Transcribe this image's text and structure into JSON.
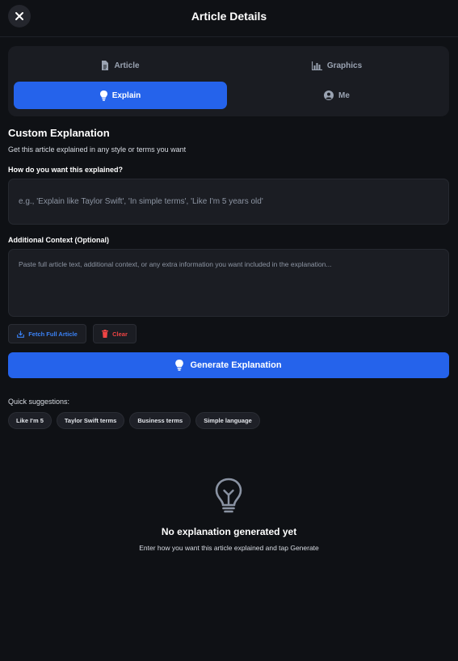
{
  "header": {
    "title": "Article Details",
    "close_icon": "close-icon"
  },
  "tabs": [
    {
      "label": "Article",
      "icon": "document-icon",
      "active": false
    },
    {
      "label": "Graphics",
      "icon": "bar-chart-icon",
      "active": false
    },
    {
      "label": "Explain",
      "icon": "lightbulb-icon",
      "active": true
    },
    {
      "label": "Me",
      "icon": "user-circle-icon",
      "active": false
    }
  ],
  "custom": {
    "title": "Custom Explanation",
    "subtitle": "Get this article explained in any style or terms you want"
  },
  "style_field": {
    "label": "How do you want this explained?",
    "placeholder": "e.g., 'Explain like Taylor Swift', 'In simple terms', 'Like I'm 5 years old'",
    "value": ""
  },
  "context_field": {
    "label": "Additional Context (Optional)",
    "placeholder": "Paste full article text, additional context, or any extra information you want included in the explanation...",
    "value": ""
  },
  "actions": {
    "fetch_label": "Fetch Full Article",
    "clear_label": "Clear",
    "generate_label": "Generate Explanation"
  },
  "quick": {
    "label": "Quick suggestions:",
    "chips": [
      "Like I'm 5",
      "Taylor Swift terms",
      "Business terms",
      "Simple language"
    ]
  },
  "empty_state": {
    "icon": "lightbulb-icon",
    "title": "No explanation generated yet",
    "subtitle": "Enter how you want this article explained and tap Generate"
  },
  "colors": {
    "background": "#0f1115",
    "accent": "#2563eb",
    "fetch_text": "#3b82f6",
    "clear_text": "#ef4444"
  }
}
